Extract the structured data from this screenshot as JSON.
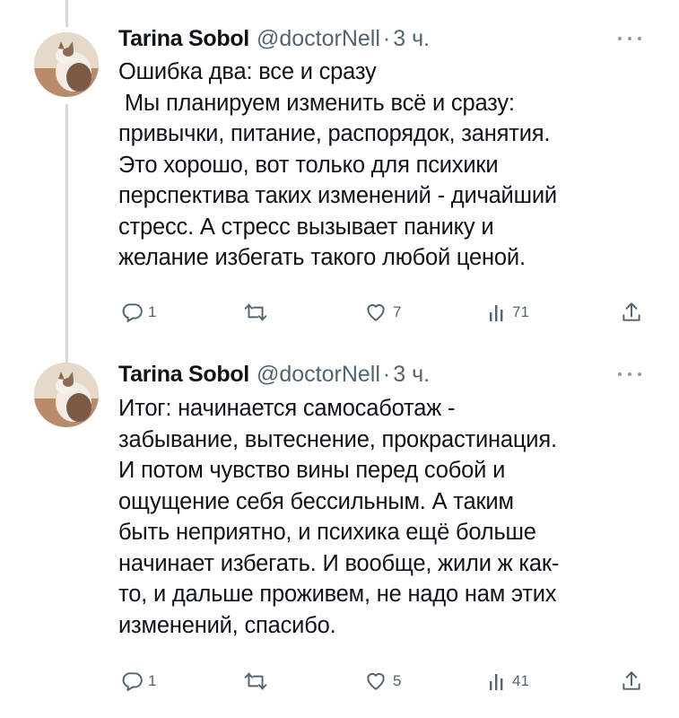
{
  "tweets": [
    {
      "author_name": "Tarina Sobol",
      "handle": "@doctorNell",
      "separator": "·",
      "time": "3 ч.",
      "lines": [
        "Ошибка два: все и сразу",
        " Мы планируем изменить всё и сразу:",
        "привычки, питание, распорядок, занятия.",
        "Это хорошо, вот только для психики",
        "перспектива таких изменений - дичайший",
        "стресс. А стресс вызывает панику и",
        "желание избегать такого любой ценой."
      ],
      "replies": "1",
      "retweets": "",
      "likes": "7",
      "views": "71"
    },
    {
      "author_name": "Tarina Sobol",
      "handle": "@doctorNell",
      "separator": "·",
      "time": "3 ч.",
      "lines": [
        "Итог: начинается самосаботаж -",
        "забывание, вытеснение, прокрастинация.",
        "И потом чувство вины перед собой и",
        "ощущение себя бессильным. А таким",
        "быть неприятно, и психика ещё больше",
        "начинает избегать. И вообще, жили ж как-",
        "то, и дальше проживем, не надо нам этих",
        "изменений, спасибо."
      ],
      "replies": "1",
      "retweets": "",
      "likes": "5",
      "views": "41"
    }
  ],
  "colors": {
    "text": "#0f1419",
    "secondary": "#536471",
    "thread_line": "#cfd9de"
  },
  "icons": [
    "reply-icon",
    "retweet-icon",
    "like-icon",
    "views-icon",
    "share-icon",
    "more-icon"
  ]
}
